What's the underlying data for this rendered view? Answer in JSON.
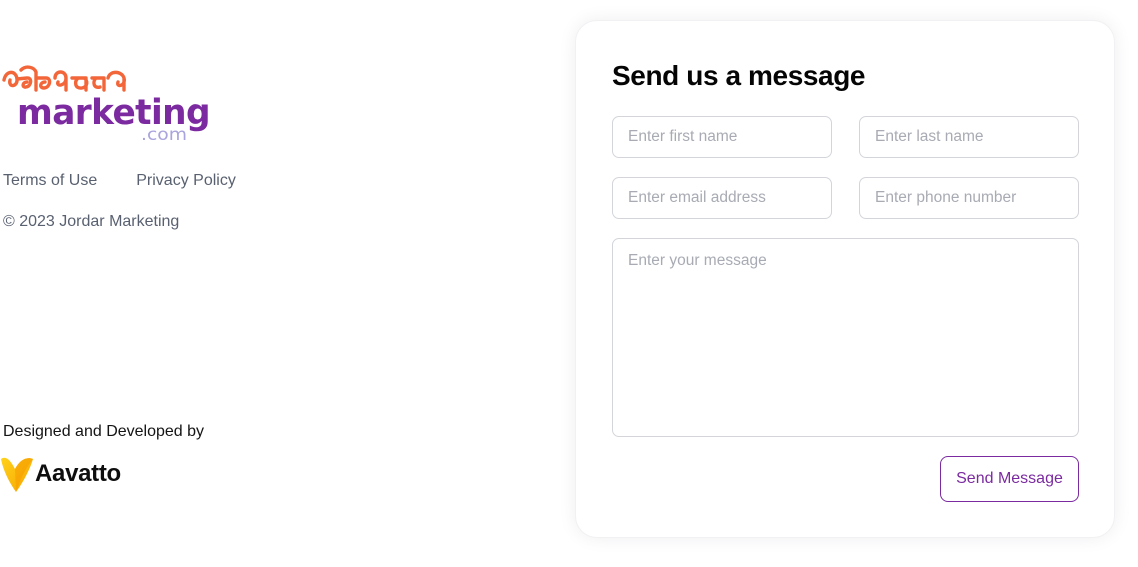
{
  "brand": {
    "logo_gujarati": "જોરદાર",
    "logo_word": "marketing",
    "logo_suffix": ".com",
    "colors": {
      "orange": "#f2663a",
      "purple": "#7b2aa0",
      "lavender": "#a9a4dd"
    }
  },
  "footer": {
    "links": [
      "Terms of Use",
      "Privacy Policy"
    ],
    "copyright": "© 2023 Jordar Marketing",
    "credit_text": "Designed and Developed by",
    "credit_name": "Aavatto",
    "credit_icon": "aavatto-logo-icon"
  },
  "form": {
    "title": "Send us a message",
    "first_name_placeholder": "Enter first name",
    "last_name_placeholder": "Enter last name",
    "email_placeholder": "Enter email address",
    "phone_placeholder": "Enter phone number",
    "message_placeholder": "Enter your message",
    "submit_label": "Send Message",
    "accent_color": "#7b2aa0"
  }
}
